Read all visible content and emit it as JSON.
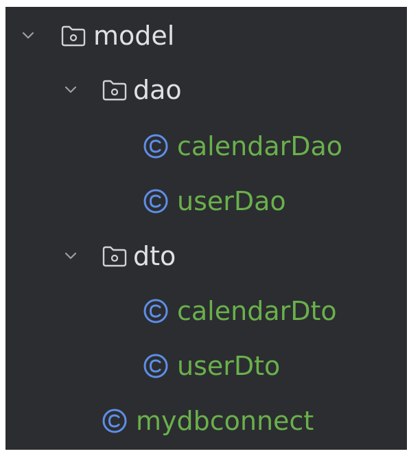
{
  "tree": {
    "model": {
      "label": "model",
      "expanded": true
    },
    "dao": {
      "label": "dao",
      "expanded": true
    },
    "calendarDao": {
      "label": "calendarDao"
    },
    "userDao": {
      "label": "userDao"
    },
    "dto": {
      "label": "dto",
      "expanded": true
    },
    "calendarDto": {
      "label": "calendarDto"
    },
    "userDto": {
      "label": "userDto"
    },
    "mydbconnect": {
      "label": "mydbconnect"
    }
  },
  "colors": {
    "background": "#2b2d30",
    "folder_text": "#dfe1e5",
    "class_text": "#6ab04c",
    "class_icon": "#5f8ee8",
    "chevron": "#9aa0a6",
    "folder_icon": "#cfd2d6"
  },
  "icons": {
    "expand": "chevron-down-icon",
    "folder": "package-folder-icon",
    "class": "class-icon"
  }
}
